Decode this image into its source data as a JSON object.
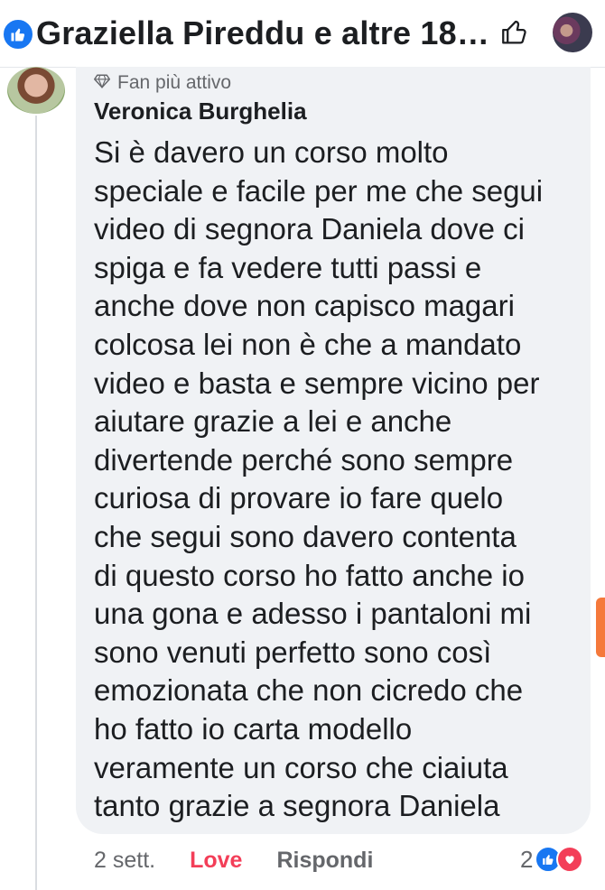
{
  "header": {
    "title": "Graziella Pireddu e altre 180 p...",
    "icons": {
      "like_badge": "like-badge-icon",
      "like_button": "thumbs-up-outline-icon",
      "avatar": "page-avatar"
    }
  },
  "comment": {
    "badge": "Fan più attivo",
    "badge_icon": "diamond-icon",
    "author": "Veronica Burghelia",
    "text": "Si è davero un corso molto\nspeciale e facile per me che segui\nvideo di segnora Daniela dove ci\nspiga e fa vedere tutti passi  e\nanche dove non capisco magari\ncolcosa lei non è che a mandato\nvideo e basta e sempre vicino per\naiutare grazie a lei e anche\ndivertende perché sono sempre\ncuriosa di provare io fare quelo\nche segui  sono davero contenta\ndi questo corso ho fatto anche io\nuna gona e adesso i pantaloni mi\nsono venuti perfetto sono così\nemozionata che non cicredo che\nho fatto io carta modello\nveramente un corso che ciaiuta\ntanto grazie a segnora Daniela",
    "actions": {
      "time": "2 sett.",
      "love": "Love",
      "reply": "Rispondi"
    },
    "reactions": {
      "count": "2",
      "types": [
        "like-reaction-icon",
        "love-reaction-icon"
      ]
    }
  },
  "colors": {
    "accent_blue": "#1877f2",
    "love_red": "#f33e58",
    "bubble_bg": "#f0f2f5",
    "secondary_text": "#65676b"
  }
}
